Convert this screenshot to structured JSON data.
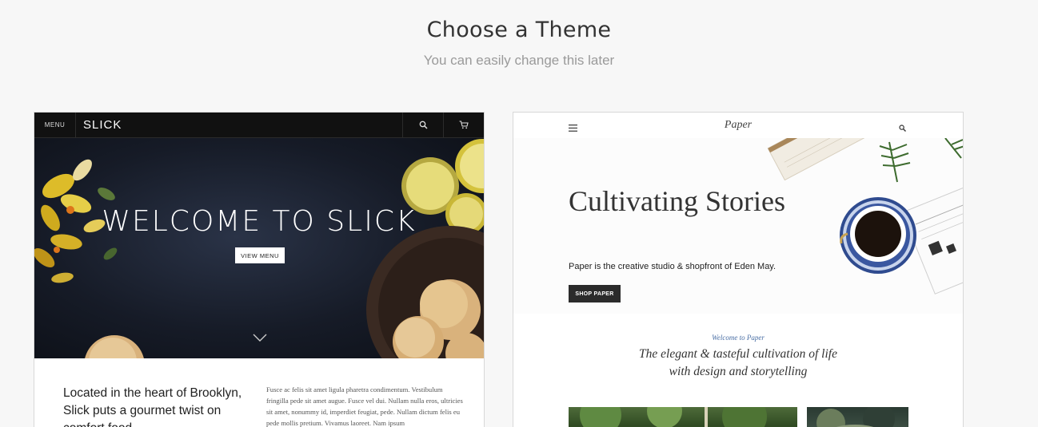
{
  "header": {
    "title": "Choose a Theme",
    "subtitle": "You can easily change this later"
  },
  "themes": {
    "slick": {
      "nav_menu": "MENU",
      "logo": "SLICK",
      "headline": "WELCOME TO SLICK",
      "button": "VIEW MENU",
      "body_heading": "Located in the heart of Brooklyn, Slick puts a gourmet twist on comfort food.",
      "body_text": "Fusce ac felis sit amet ligula pharetra condimentum. Vestibulum fringilla pede sit amet augue. Fusce vel dui. Nullam nulla eros, ultricies sit amet, nonummy id, imperdiet feugiat, pede. Nullam dictum felis eu pede mollis pretium. Vivamus laoreet. Nam ipsum"
    },
    "paper": {
      "logo": "Paper",
      "headline": "Cultivating Stories",
      "tagline": "Paper is the creative studio & shopfront of Eden May.",
      "button": "SHOP PAPER",
      "welcome": "Welcome to Paper",
      "elegant_text": "The elegant & tasteful cultivation of life with design and storytelling"
    }
  },
  "icons": {
    "search": "search-icon",
    "cart": "cart-icon",
    "menu": "hamburger-icon",
    "chevron": "chevron-down-icon"
  },
  "colors": {
    "background": "#f7f7f7",
    "slick_nav": "#111111",
    "paper_button": "#2b2b2b",
    "paper_accent": "#4a6fa5"
  }
}
